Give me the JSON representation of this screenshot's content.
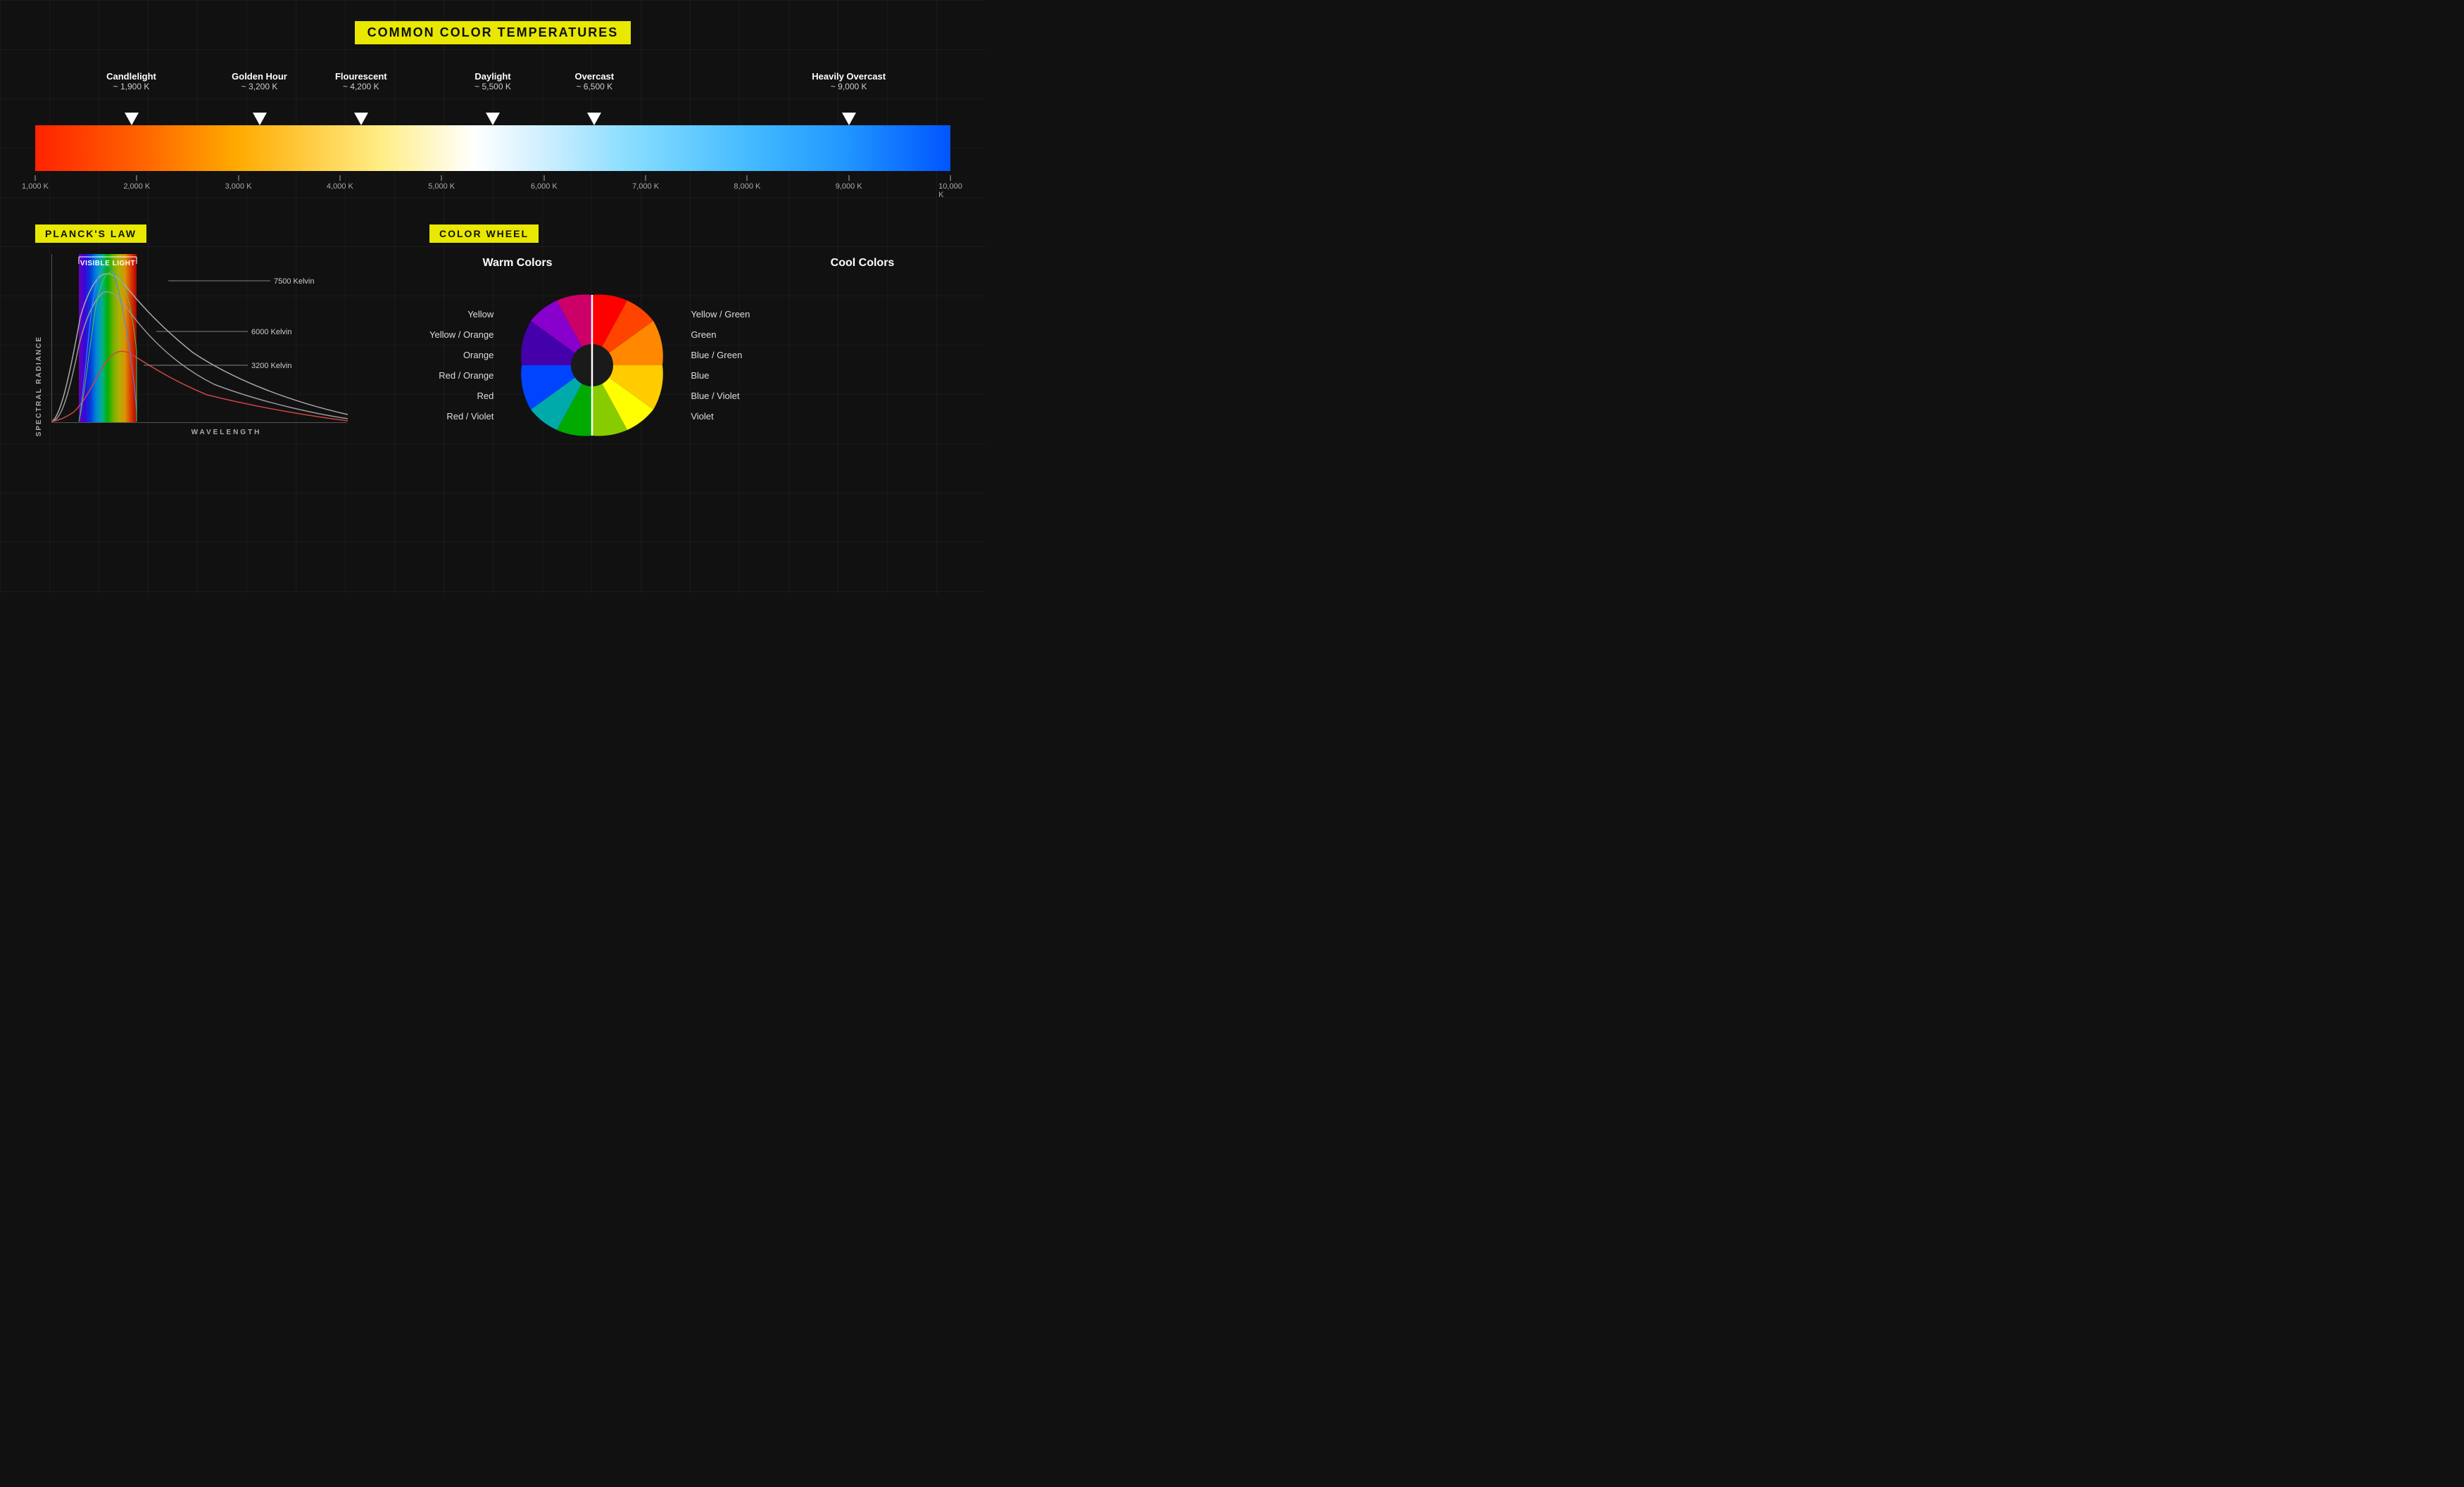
{
  "page": {
    "title": "COMMON COLOR TEMPERATURES",
    "background": "#111"
  },
  "top_section": {
    "title": "COMMON COLOR TEMPERATURES",
    "labels": [
      {
        "name": "Candlelight",
        "value": "~ 1,900 K",
        "pct": 10.5
      },
      {
        "name": "Golden Hour",
        "value": "~ 3,200 K",
        "pct": 24.5
      },
      {
        "name": "Flourescent",
        "value": "~ 4,200 K",
        "pct": 35.6
      },
      {
        "name": "Daylight",
        "value": "~ 5,500 K",
        "pct": 50.0
      },
      {
        "name": "Overcast",
        "value": "~ 6,500 K",
        "pct": 61.1
      },
      {
        "name": "Heavily Overcast",
        "value": "~ 9,000 K",
        "pct": 88.9
      }
    ],
    "scale": [
      {
        "label": "1,000 K",
        "pct": 0
      },
      {
        "label": "2,000 K",
        "pct": 11.1
      },
      {
        "label": "3,000 K",
        "pct": 22.2
      },
      {
        "label": "4,000 K",
        "pct": 33.3
      },
      {
        "label": "5,000 K",
        "pct": 44.4
      },
      {
        "label": "6,000 K",
        "pct": 55.6
      },
      {
        "label": "7,000 K",
        "pct": 66.7
      },
      {
        "label": "8,000 K",
        "pct": 77.8
      },
      {
        "label": "9,000 K",
        "pct": 88.9
      },
      {
        "label": "10,000 K",
        "pct": 100
      }
    ]
  },
  "plancks": {
    "badge": "PLANCK'S LAW",
    "y_axis": "SPECTRAL RADIANCE",
    "x_axis": "WAVELENGTH",
    "visible_light_label": "VISIBLE LIGHT",
    "curves": [
      {
        "label": "7500 Kelvin",
        "label_x": 310,
        "label_y": 38
      },
      {
        "label": "6000 Kelvin",
        "label_x": 280,
        "label_y": 110
      },
      {
        "label": "3200 Kelvin",
        "label_x": 280,
        "label_y": 158
      }
    ]
  },
  "color_wheel": {
    "badge": "COLOR WHEEL",
    "warm_header": "Warm Colors",
    "cool_header": "Cool Colors",
    "warm_labels": [
      "Yellow",
      "Yellow / Orange",
      "Orange",
      "Red / Orange",
      "Red",
      "Red / Violet"
    ],
    "cool_labels": [
      "Yellow / Green",
      "Green",
      "Blue / Green",
      "Blue",
      "Blue / Violet",
      "Violet"
    ]
  }
}
